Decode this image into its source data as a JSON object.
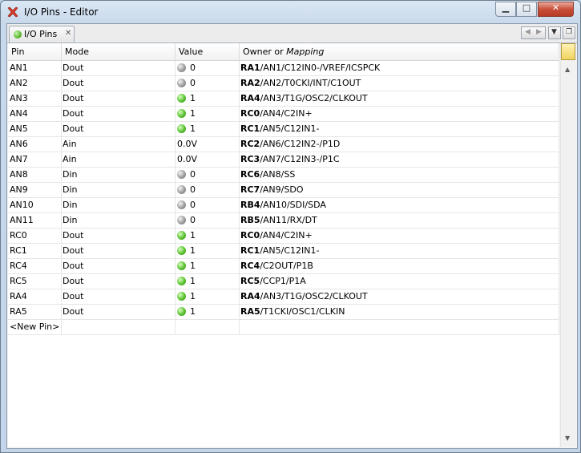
{
  "window": {
    "title": "I/O Pins - Editor"
  },
  "titlebar_buttons": {
    "minimize": "▁",
    "maximize": "□",
    "close": "✕"
  },
  "tab": {
    "label": "I/O Pins",
    "close_glyph": "✕",
    "led": "green"
  },
  "nav": {
    "left": "◀",
    "right": "▶",
    "down": "▼",
    "window": "❐"
  },
  "columns": {
    "pin": "Pin",
    "mode": "Mode",
    "value": "Value",
    "owner": "Owner or ",
    "owner_em": "Mapping"
  },
  "rows": [
    {
      "pin": "AN1",
      "mode": "Dout",
      "led": "off",
      "value": "0",
      "owner": "RA1",
      "mapping": "/AN1/C12IN0-/VREF/ICSPCK"
    },
    {
      "pin": "AN2",
      "mode": "Dout",
      "led": "off",
      "value": "0",
      "owner": "RA2",
      "mapping": "/AN2/T0CKI/INT/C1OUT"
    },
    {
      "pin": "AN3",
      "mode": "Dout",
      "led": "on",
      "value": "1",
      "owner": "RA4",
      "mapping": "/AN3/T1G/OSC2/CLKOUT"
    },
    {
      "pin": "AN4",
      "mode": "Dout",
      "led": "on",
      "value": "1",
      "owner": "RC0",
      "mapping": "/AN4/C2IN+"
    },
    {
      "pin": "AN5",
      "mode": "Dout",
      "led": "on",
      "value": "1",
      "owner": "RC1",
      "mapping": "/AN5/C12IN1-"
    },
    {
      "pin": "AN6",
      "mode": "Ain",
      "led": "",
      "value": "0.0V",
      "owner": "RC2",
      "mapping": "/AN6/C12IN2-/P1D"
    },
    {
      "pin": "AN7",
      "mode": "Ain",
      "led": "",
      "value": "0.0V",
      "owner": "RC3",
      "mapping": "/AN7/C12IN3-/P1C"
    },
    {
      "pin": "AN8",
      "mode": "Din",
      "led": "off",
      "value": "0",
      "owner": "RC6",
      "mapping": "/AN8/SS"
    },
    {
      "pin": "AN9",
      "mode": "Din",
      "led": "off",
      "value": "0",
      "owner": "RC7",
      "mapping": "/AN9/SDO"
    },
    {
      "pin": "AN10",
      "mode": "Din",
      "led": "off",
      "value": "0",
      "owner": "RB4",
      "mapping": "/AN10/SDI/SDA"
    },
    {
      "pin": "AN11",
      "mode": "Din",
      "led": "off",
      "value": "0",
      "owner": "RB5",
      "mapping": "/AN11/RX/DT"
    },
    {
      "pin": "RC0",
      "mode": "Dout",
      "led": "on",
      "value": "1",
      "owner": "RC0",
      "mapping": "/AN4/C2IN+"
    },
    {
      "pin": "RC1",
      "mode": "Dout",
      "led": "on",
      "value": "1",
      "owner": "RC1",
      "mapping": "/AN5/C12IN1-"
    },
    {
      "pin": "RC4",
      "mode": "Dout",
      "led": "on",
      "value": "1",
      "owner": "RC4",
      "mapping": "/C2OUT/P1B"
    },
    {
      "pin": "RC5",
      "mode": "Dout",
      "led": "on",
      "value": "1",
      "owner": "RC5",
      "mapping": "/CCP1/P1A"
    },
    {
      "pin": "RA4",
      "mode": "Dout",
      "led": "on",
      "value": "1",
      "owner": "RA4",
      "mapping": "/AN3/T1G/OSC2/CLKOUT"
    },
    {
      "pin": "RA5",
      "mode": "Dout",
      "led": "on",
      "value": "1",
      "owner": "RA5",
      "mapping": "/T1CKI/OSC1/CLKIN"
    }
  ],
  "new_pin_label": "<New Pin>",
  "scroll": {
    "up": "▲",
    "down": "▼"
  },
  "colors": {
    "led_on": "#5cc231",
    "led_off": "#9d9d9d"
  }
}
